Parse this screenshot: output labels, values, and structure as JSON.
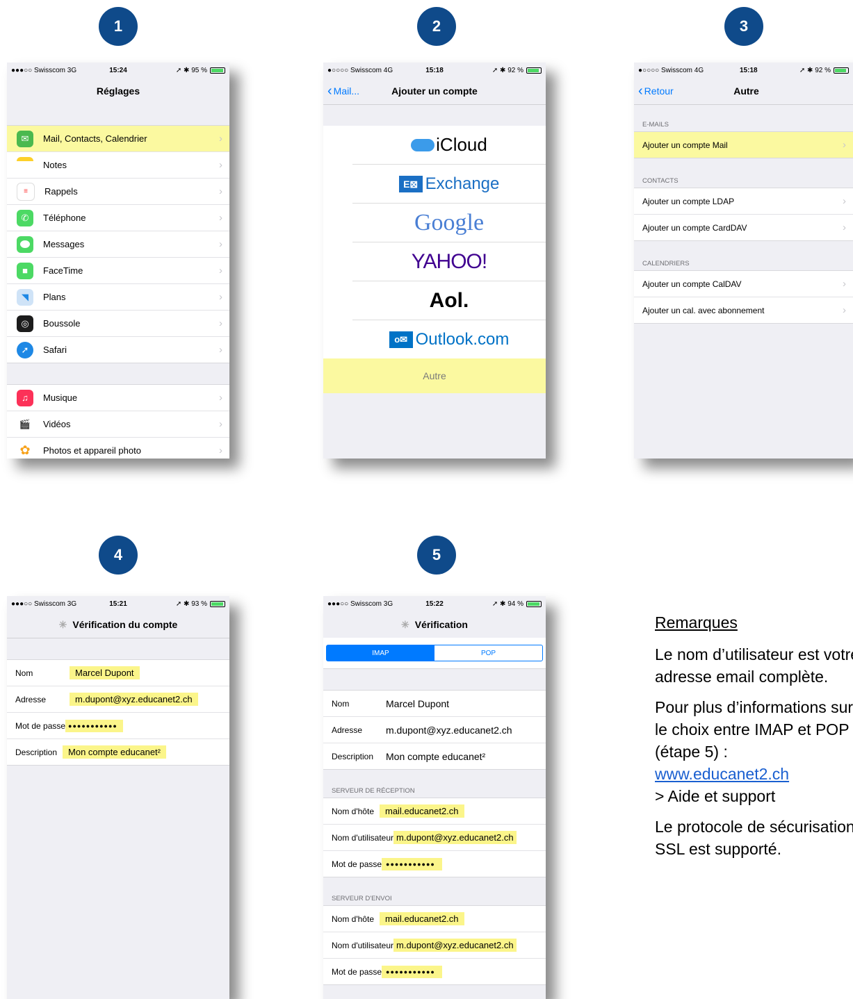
{
  "steps": [
    "1",
    "2",
    "3",
    "4",
    "5"
  ],
  "phone1": {
    "status": {
      "carrier": "●●●○○ Swisscom  3G",
      "time": "15:24",
      "battery": "➚ ✱ 95 %"
    },
    "title": "Réglages",
    "group1": [
      {
        "label": "Mail, Contacts, Calendrier",
        "icon": "mail-icon",
        "color": "#4bb94f",
        "highlight": true
      },
      {
        "label": "Notes",
        "icon": "notes-icon",
        "color": "#fdd02a"
      },
      {
        "label": "Rappels",
        "icon": "reminders-icon",
        "color": "#ffffff"
      },
      {
        "label": "Téléphone",
        "icon": "phone-icon",
        "color": "#4cd964"
      },
      {
        "label": "Messages",
        "icon": "messages-icon",
        "color": "#4cd964"
      },
      {
        "label": "FaceTime",
        "icon": "facetime-icon",
        "color": "#4cd964"
      },
      {
        "label": "Plans",
        "icon": "maps-icon",
        "color": "#7fb6e8"
      },
      {
        "label": "Boussole",
        "icon": "compass-icon",
        "color": "#1c1c1c"
      },
      {
        "label": "Safari",
        "icon": "safari-icon",
        "color": "#1e88e5"
      }
    ],
    "group2": [
      {
        "label": "Musique",
        "icon": "music-icon",
        "color": "#fc3158"
      },
      {
        "label": "Vidéos",
        "icon": "videos-icon",
        "color": "#2b2b2b"
      },
      {
        "label": "Photos et appareil photo",
        "icon": "photos-icon",
        "color": "#ffffff"
      }
    ]
  },
  "phone2": {
    "status": {
      "carrier": "●○○○○ Swisscom  4G",
      "time": "15:18",
      "battery": "➚ ✱ 92 %"
    },
    "back": "Mail...",
    "title": "Ajouter un compte",
    "providers": {
      "icloud": "iCloud",
      "exchange": "Exchange",
      "google": "Google",
      "yahoo": "YAHOO!",
      "aol": "Aol.",
      "outlook": "Outlook.com"
    },
    "other": "Autre"
  },
  "phone3": {
    "status": {
      "carrier": "●○○○○ Swisscom  4G",
      "time": "15:18",
      "battery": "➚ ✱ 92 %"
    },
    "back": "Retour",
    "title": "Autre",
    "sections": [
      {
        "header": "E-MAILS",
        "rows": [
          "Ajouter un compte Mail"
        ]
      },
      {
        "header": "CONTACTS",
        "rows": [
          "Ajouter un compte LDAP",
          "Ajouter un compte CardDAV"
        ]
      },
      {
        "header": "CALENDRIERS",
        "rows": [
          "Ajouter un compte CalDAV",
          "Ajouter un cal. avec abonnement"
        ]
      }
    ]
  },
  "phone4": {
    "status": {
      "carrier": "●●●○○ Swisscom  3G",
      "time": "15:21",
      "battery": "➚ ✱ 93 %"
    },
    "title": "Vérification du compte",
    "fields": [
      {
        "label": "Nom",
        "value": "Marcel Dupont"
      },
      {
        "label": "Adresse",
        "value": "m.dupont@xyz.educanet2.ch"
      },
      {
        "label": "Mot de passe",
        "value": "●●●●●●●●●●●"
      },
      {
        "label": "Description",
        "value": "Mon compte educanet²"
      }
    ]
  },
  "phone5": {
    "status": {
      "carrier": "●●●○○ Swisscom  3G",
      "time": "15:22",
      "battery": "➚ ✱ 94 %"
    },
    "title": "Vérification",
    "segments": [
      "IMAP",
      "POP"
    ],
    "account": [
      {
        "label": "Nom",
        "value": "Marcel Dupont"
      },
      {
        "label": "Adresse",
        "value": "m.dupont@xyz.educanet2.ch"
      },
      {
        "label": "Description",
        "value": "Mon compte educanet²"
      }
    ],
    "incoming_header": "SERVEUR DE RÉCEPTION",
    "incoming": [
      {
        "label": "Nom d'hôte",
        "value": "mail.educanet2.ch"
      },
      {
        "label": "Nom d'utilisateur",
        "value": "m.dupont@xyz.educanet2.ch"
      },
      {
        "label": "Mot de passe",
        "value": "●●●●●●●●●●●"
      }
    ],
    "outgoing_header": "SERVEUR D'ENVOI",
    "outgoing": [
      {
        "label": "Nom d'hôte",
        "value": "mail.educanet2.ch"
      },
      {
        "label": "Nom d'utilisateur",
        "value": "m.dupont@xyz.educanet2.ch"
      },
      {
        "label": "Mot de passe",
        "value": "●●●●●●●●●●●"
      }
    ]
  },
  "remarks": {
    "title": "Remarques",
    "p1": "Le nom d’utilisateur est votre adresse email complète.",
    "p2_text": "Pour plus d’informations sur le choix entre IMAP et POP (étape 5) :",
    "p2_link": "www.educanet2.ch",
    "p2_after": "> Aide et support",
    "p3": "Le protocole de sécurisation SSL est supporté."
  }
}
